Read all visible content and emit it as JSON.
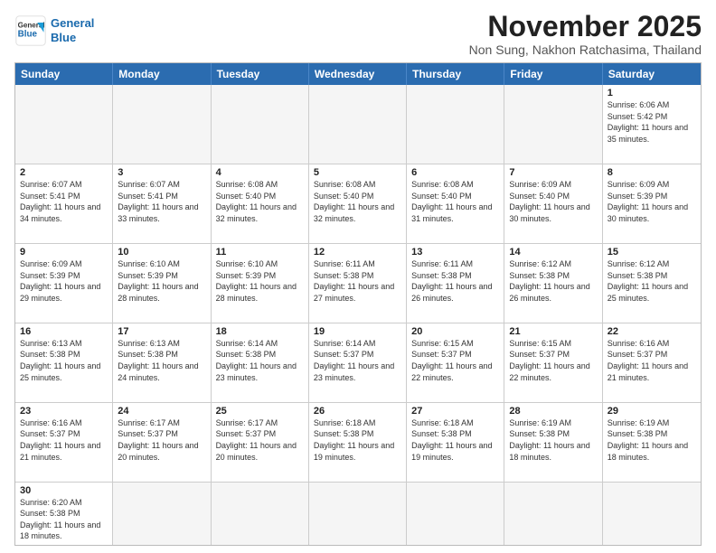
{
  "header": {
    "logo_line1": "General",
    "logo_line2": "Blue",
    "month": "November 2025",
    "location": "Non Sung, Nakhon Ratchasima, Thailand"
  },
  "days_of_week": [
    "Sunday",
    "Monday",
    "Tuesday",
    "Wednesday",
    "Thursday",
    "Friday",
    "Saturday"
  ],
  "weeks": [
    [
      {
        "day": "",
        "sunrise": "",
        "sunset": "",
        "daylight": ""
      },
      {
        "day": "",
        "sunrise": "",
        "sunset": "",
        "daylight": ""
      },
      {
        "day": "",
        "sunrise": "",
        "sunset": "",
        "daylight": ""
      },
      {
        "day": "",
        "sunrise": "",
        "sunset": "",
        "daylight": ""
      },
      {
        "day": "",
        "sunrise": "",
        "sunset": "",
        "daylight": ""
      },
      {
        "day": "",
        "sunrise": "",
        "sunset": "",
        "daylight": ""
      },
      {
        "day": "1",
        "sunrise": "Sunrise: 6:06 AM",
        "sunset": "Sunset: 5:42 PM",
        "daylight": "Daylight: 11 hours and 35 minutes."
      }
    ],
    [
      {
        "day": "2",
        "sunrise": "Sunrise: 6:07 AM",
        "sunset": "Sunset: 5:41 PM",
        "daylight": "Daylight: 11 hours and 34 minutes."
      },
      {
        "day": "3",
        "sunrise": "Sunrise: 6:07 AM",
        "sunset": "Sunset: 5:41 PM",
        "daylight": "Daylight: 11 hours and 33 minutes."
      },
      {
        "day": "4",
        "sunrise": "Sunrise: 6:08 AM",
        "sunset": "Sunset: 5:40 PM",
        "daylight": "Daylight: 11 hours and 32 minutes."
      },
      {
        "day": "5",
        "sunrise": "Sunrise: 6:08 AM",
        "sunset": "Sunset: 5:40 PM",
        "daylight": "Daylight: 11 hours and 32 minutes."
      },
      {
        "day": "6",
        "sunrise": "Sunrise: 6:08 AM",
        "sunset": "Sunset: 5:40 PM",
        "daylight": "Daylight: 11 hours and 31 minutes."
      },
      {
        "day": "7",
        "sunrise": "Sunrise: 6:09 AM",
        "sunset": "Sunset: 5:40 PM",
        "daylight": "Daylight: 11 hours and 30 minutes."
      },
      {
        "day": "8",
        "sunrise": "Sunrise: 6:09 AM",
        "sunset": "Sunset: 5:39 PM",
        "daylight": "Daylight: 11 hours and 30 minutes."
      }
    ],
    [
      {
        "day": "9",
        "sunrise": "Sunrise: 6:09 AM",
        "sunset": "Sunset: 5:39 PM",
        "daylight": "Daylight: 11 hours and 29 minutes."
      },
      {
        "day": "10",
        "sunrise": "Sunrise: 6:10 AM",
        "sunset": "Sunset: 5:39 PM",
        "daylight": "Daylight: 11 hours and 28 minutes."
      },
      {
        "day": "11",
        "sunrise": "Sunrise: 6:10 AM",
        "sunset": "Sunset: 5:39 PM",
        "daylight": "Daylight: 11 hours and 28 minutes."
      },
      {
        "day": "12",
        "sunrise": "Sunrise: 6:11 AM",
        "sunset": "Sunset: 5:38 PM",
        "daylight": "Daylight: 11 hours and 27 minutes."
      },
      {
        "day": "13",
        "sunrise": "Sunrise: 6:11 AM",
        "sunset": "Sunset: 5:38 PM",
        "daylight": "Daylight: 11 hours and 26 minutes."
      },
      {
        "day": "14",
        "sunrise": "Sunrise: 6:12 AM",
        "sunset": "Sunset: 5:38 PM",
        "daylight": "Daylight: 11 hours and 26 minutes."
      },
      {
        "day": "15",
        "sunrise": "Sunrise: 6:12 AM",
        "sunset": "Sunset: 5:38 PM",
        "daylight": "Daylight: 11 hours and 25 minutes."
      }
    ],
    [
      {
        "day": "16",
        "sunrise": "Sunrise: 6:13 AM",
        "sunset": "Sunset: 5:38 PM",
        "daylight": "Daylight: 11 hours and 25 minutes."
      },
      {
        "day": "17",
        "sunrise": "Sunrise: 6:13 AM",
        "sunset": "Sunset: 5:38 PM",
        "daylight": "Daylight: 11 hours and 24 minutes."
      },
      {
        "day": "18",
        "sunrise": "Sunrise: 6:14 AM",
        "sunset": "Sunset: 5:38 PM",
        "daylight": "Daylight: 11 hours and 23 minutes."
      },
      {
        "day": "19",
        "sunrise": "Sunrise: 6:14 AM",
        "sunset": "Sunset: 5:37 PM",
        "daylight": "Daylight: 11 hours and 23 minutes."
      },
      {
        "day": "20",
        "sunrise": "Sunrise: 6:15 AM",
        "sunset": "Sunset: 5:37 PM",
        "daylight": "Daylight: 11 hours and 22 minutes."
      },
      {
        "day": "21",
        "sunrise": "Sunrise: 6:15 AM",
        "sunset": "Sunset: 5:37 PM",
        "daylight": "Daylight: 11 hours and 22 minutes."
      },
      {
        "day": "22",
        "sunrise": "Sunrise: 6:16 AM",
        "sunset": "Sunset: 5:37 PM",
        "daylight": "Daylight: 11 hours and 21 minutes."
      }
    ],
    [
      {
        "day": "23",
        "sunrise": "Sunrise: 6:16 AM",
        "sunset": "Sunset: 5:37 PM",
        "daylight": "Daylight: 11 hours and 21 minutes."
      },
      {
        "day": "24",
        "sunrise": "Sunrise: 6:17 AM",
        "sunset": "Sunset: 5:37 PM",
        "daylight": "Daylight: 11 hours and 20 minutes."
      },
      {
        "day": "25",
        "sunrise": "Sunrise: 6:17 AM",
        "sunset": "Sunset: 5:37 PM",
        "daylight": "Daylight: 11 hours and 20 minutes."
      },
      {
        "day": "26",
        "sunrise": "Sunrise: 6:18 AM",
        "sunset": "Sunset: 5:38 PM",
        "daylight": "Daylight: 11 hours and 19 minutes."
      },
      {
        "day": "27",
        "sunrise": "Sunrise: 6:18 AM",
        "sunset": "Sunset: 5:38 PM",
        "daylight": "Daylight: 11 hours and 19 minutes."
      },
      {
        "day": "28",
        "sunrise": "Sunrise: 6:19 AM",
        "sunset": "Sunset: 5:38 PM",
        "daylight": "Daylight: 11 hours and 18 minutes."
      },
      {
        "day": "29",
        "sunrise": "Sunrise: 6:19 AM",
        "sunset": "Sunset: 5:38 PM",
        "daylight": "Daylight: 11 hours and 18 minutes."
      }
    ],
    [
      {
        "day": "30",
        "sunrise": "Sunrise: 6:20 AM",
        "sunset": "Sunset: 5:38 PM",
        "daylight": "Daylight: 11 hours and 18 minutes."
      },
      {
        "day": "",
        "sunrise": "",
        "sunset": "",
        "daylight": ""
      },
      {
        "day": "",
        "sunrise": "",
        "sunset": "",
        "daylight": ""
      },
      {
        "day": "",
        "sunrise": "",
        "sunset": "",
        "daylight": ""
      },
      {
        "day": "",
        "sunrise": "",
        "sunset": "",
        "daylight": ""
      },
      {
        "day": "",
        "sunrise": "",
        "sunset": "",
        "daylight": ""
      },
      {
        "day": "",
        "sunrise": "",
        "sunset": "",
        "daylight": ""
      }
    ]
  ]
}
